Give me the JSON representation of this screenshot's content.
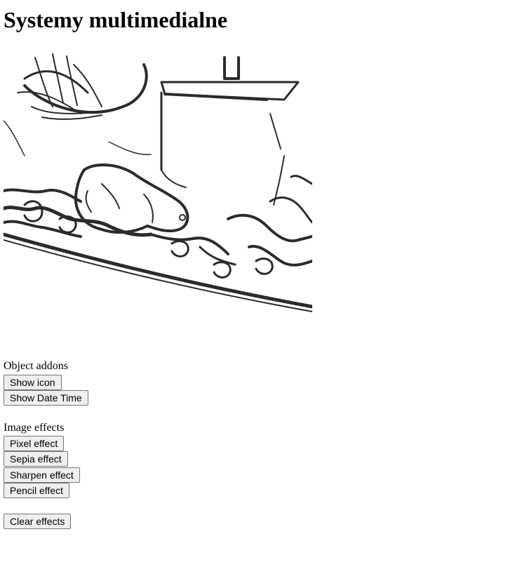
{
  "page": {
    "title": "Systemy multimedialne"
  },
  "preview": {
    "image_name": "pencil-sketch-image",
    "active_effect": "Pencil effect"
  },
  "object_addons": {
    "label": "Object addons",
    "buttons": {
      "show_icon": "Show icon",
      "show_date_time": "Show Date Time"
    }
  },
  "image_effects": {
    "label": "Image effects",
    "buttons": {
      "pixel": "Pixel effect",
      "sepia": "Sepia effect",
      "sharpen": "Sharpen effect",
      "pencil": "Pencil effect"
    }
  },
  "actions": {
    "clear": "Clear effects"
  },
  "colors": {
    "button_bg": "#efefef",
    "button_border": "#767676",
    "sketch_ink": "#2b2b2b"
  }
}
